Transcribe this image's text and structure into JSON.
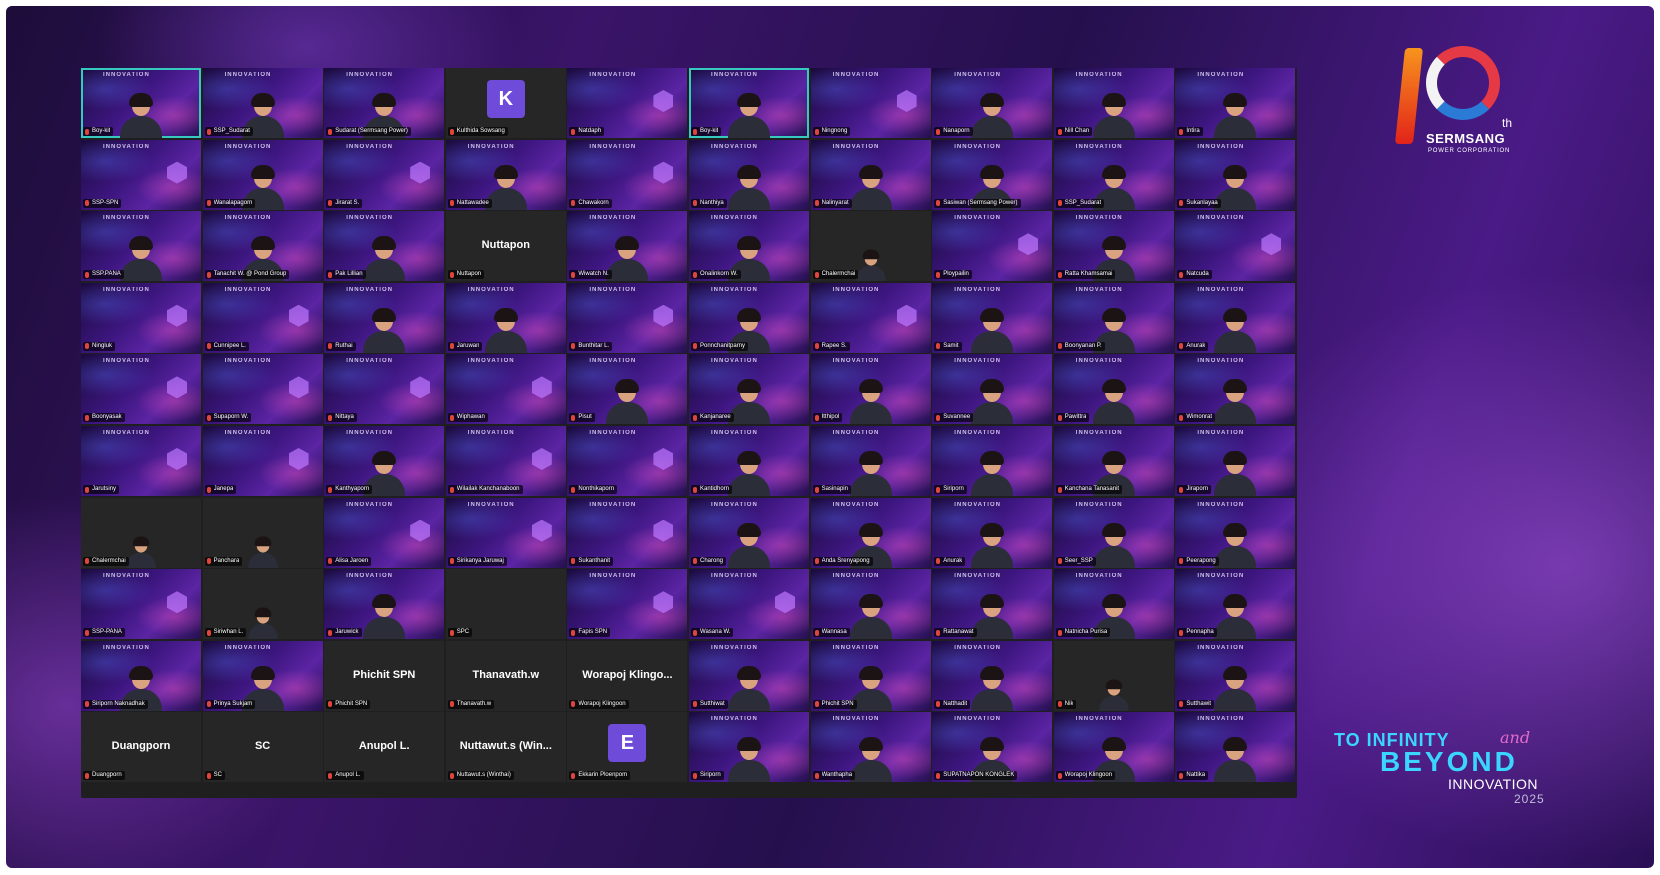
{
  "meeting": {
    "tiles": [
      {
        "name": "Boy-kit",
        "kind": "video",
        "active": true
      },
      {
        "name": "SSP_Sudarat",
        "kind": "video"
      },
      {
        "name": "Sudarat (Sermsang Power)",
        "kind": "video"
      },
      {
        "name": "Kulthida Sowsang",
        "kind": "letter",
        "letter": "K"
      },
      {
        "name": "Natdaph",
        "kind": "bg"
      },
      {
        "name": "Boy-kit",
        "kind": "video",
        "active": true
      },
      {
        "name": "Ningnong",
        "kind": "bg"
      },
      {
        "name": "Nanaporn",
        "kind": "video"
      },
      {
        "name": "Nill Chan",
        "kind": "video"
      },
      {
        "name": "Intira",
        "kind": "video"
      },
      {
        "name": "SSP-SPN",
        "kind": "bg"
      },
      {
        "name": "Wanalapagorn",
        "kind": "video"
      },
      {
        "name": "Jirarat S.",
        "kind": "bg"
      },
      {
        "name": "Nattawadee",
        "kind": "video"
      },
      {
        "name": "Chawakorn",
        "kind": "bg"
      },
      {
        "name": "Nanthiya",
        "kind": "video"
      },
      {
        "name": "Nalinyarat",
        "kind": "video"
      },
      {
        "name": "Sasiwan (Sermsang Power)",
        "kind": "video"
      },
      {
        "name": "SSP_Sudarat",
        "kind": "video"
      },
      {
        "name": "Sukanlayaa",
        "kind": "video"
      },
      {
        "name": "SSP.PANA",
        "kind": "video"
      },
      {
        "name": "Tanachit W. @ Pond Group",
        "kind": "video"
      },
      {
        "name": "Pak Lillian",
        "kind": "video"
      },
      {
        "name": "Nuttapon",
        "kind": "dark-name",
        "display": "Nuttapon"
      },
      {
        "name": "Wiwatch N.",
        "kind": "video"
      },
      {
        "name": "Onalinkorn W.",
        "kind": "video"
      },
      {
        "name": "Chalermchai",
        "kind": "dark-video"
      },
      {
        "name": "Ploypailin",
        "kind": "bg"
      },
      {
        "name": "Ratta Khamsamai",
        "kind": "video"
      },
      {
        "name": "Natcuda",
        "kind": "bg"
      },
      {
        "name": "Ningluk",
        "kind": "bg"
      },
      {
        "name": "Cunnipee L.",
        "kind": "bg"
      },
      {
        "name": "Ruthai",
        "kind": "video"
      },
      {
        "name": "Jaruwan",
        "kind": "video"
      },
      {
        "name": "Bunthitar L.",
        "kind": "bg"
      },
      {
        "name": "Ponnchanitparny",
        "kind": "video"
      },
      {
        "name": "Rapee S.",
        "kind": "bg"
      },
      {
        "name": "Samit",
        "kind": "video"
      },
      {
        "name": "Boonyanan P.",
        "kind": "video"
      },
      {
        "name": "Anurak",
        "kind": "video"
      },
      {
        "name": "Boonyasak",
        "kind": "bg"
      },
      {
        "name": "Supaporn W.",
        "kind": "bg"
      },
      {
        "name": "Nittaya",
        "kind": "bg"
      },
      {
        "name": "Wiphawan",
        "kind": "bg"
      },
      {
        "name": "Pisut",
        "kind": "video"
      },
      {
        "name": "Kanjanaree",
        "kind": "video"
      },
      {
        "name": "Itthipol",
        "kind": "video"
      },
      {
        "name": "Suvannee",
        "kind": "video"
      },
      {
        "name": "Pawittra",
        "kind": "video"
      },
      {
        "name": "Wimonrat",
        "kind": "video"
      },
      {
        "name": "Jarutsiny",
        "kind": "bg"
      },
      {
        "name": "Janepa",
        "kind": "bg"
      },
      {
        "name": "Kanthyaporn",
        "kind": "video"
      },
      {
        "name": "Wilailak Kanchanaboon",
        "kind": "bg"
      },
      {
        "name": "Nonthikaporn",
        "kind": "bg"
      },
      {
        "name": "Kantidhorn",
        "kind": "video"
      },
      {
        "name": "Sasinapin",
        "kind": "video"
      },
      {
        "name": "Siriporn",
        "kind": "video"
      },
      {
        "name": "Kanchana Tanasanit",
        "kind": "video"
      },
      {
        "name": "Jiraporn",
        "kind": "video"
      },
      {
        "name": "Chalermchai",
        "kind": "dark-video"
      },
      {
        "name": "Panchara",
        "kind": "dark-video"
      },
      {
        "name": "Alisa Jaroen",
        "kind": "bg"
      },
      {
        "name": "Sirikanya Jaruwaj",
        "kind": "bg"
      },
      {
        "name": "Sukanthanit",
        "kind": "bg"
      },
      {
        "name": "Charong",
        "kind": "video"
      },
      {
        "name": "Anda Srenyapong",
        "kind": "video"
      },
      {
        "name": "Anurak",
        "kind": "video"
      },
      {
        "name": "Seer_SSP",
        "kind": "video"
      },
      {
        "name": "Peerapong",
        "kind": "video"
      },
      {
        "name": "SSP-PANA",
        "kind": "bg"
      },
      {
        "name": "Siriwhan L.",
        "kind": "dark-video"
      },
      {
        "name": "Jaruwick",
        "kind": "video"
      },
      {
        "name": "SPC",
        "kind": "dark"
      },
      {
        "name": "Fapis SPN",
        "kind": "bg"
      },
      {
        "name": "Wasana W.",
        "kind": "bg"
      },
      {
        "name": "Wannasa",
        "kind": "video"
      },
      {
        "name": "Rattanawat",
        "kind": "video"
      },
      {
        "name": "Natnicha Purisa",
        "kind": "video"
      },
      {
        "name": "Pennapha",
        "kind": "video"
      },
      {
        "name": "Siriporn Naknadhak",
        "kind": "video"
      },
      {
        "name": "Prinya Sukjam",
        "kind": "video"
      },
      {
        "name": "Phichit SPN",
        "kind": "dark-name",
        "display": "Phichit SPN"
      },
      {
        "name": "Thanavath.w",
        "kind": "dark-name",
        "display": "Thanavath.w"
      },
      {
        "name": "Worapoj Klingoon",
        "kind": "dark-name",
        "display": "Worapoj  Klingo..."
      },
      {
        "name": "Sutthiwat",
        "kind": "video"
      },
      {
        "name": "Phichit SPN",
        "kind": "video"
      },
      {
        "name": "Natthadit",
        "kind": "video"
      },
      {
        "name": "Nik",
        "kind": "dark-video"
      },
      {
        "name": "Sutthawit",
        "kind": "video"
      },
      {
        "name": "Duangporn",
        "kind": "dark-name",
        "display": "Duangporn"
      },
      {
        "name": "SC",
        "kind": "dark-name",
        "display": "SC"
      },
      {
        "name": "Anupol L.",
        "kind": "dark-name",
        "display": "Anupol L."
      },
      {
        "name": "Nuttawut.s (Winthai)",
        "kind": "dark-name",
        "display": "Nuttawut.s  (Win..."
      },
      {
        "name": "Ekkarin Ploenpom",
        "kind": "letter",
        "letter": "E"
      },
      {
        "name": "Siriporn",
        "kind": "video"
      },
      {
        "name": "Wanthapha",
        "kind": "video"
      },
      {
        "name": "SUPATNAPON KONGLEK",
        "kind": "video"
      },
      {
        "name": "Worapoj Klingoon",
        "kind": "video"
      },
      {
        "name": "Nattika",
        "kind": "video"
      }
    ]
  },
  "branding": {
    "anniversary_number": "10",
    "anniversary_suffix": "th",
    "company": "SERMSANG",
    "company_sub": "POWER CORPORATION",
    "tagline_line1": "TO INFINITY",
    "tagline_and": "and",
    "tagline_line2": "BEYOND",
    "tagline_line3": "INNOVATION",
    "tagline_year": "2025",
    "tile_banner": "INNOVATION"
  },
  "colors": {
    "accent_active": "#35c9c0",
    "brand_orange": "#f7941d",
    "brand_red": "#e63946",
    "tagline_cyan": "#3ad6ff",
    "mic_muted": "#e0453a",
    "letter_avatar": "#6e4bd8"
  }
}
